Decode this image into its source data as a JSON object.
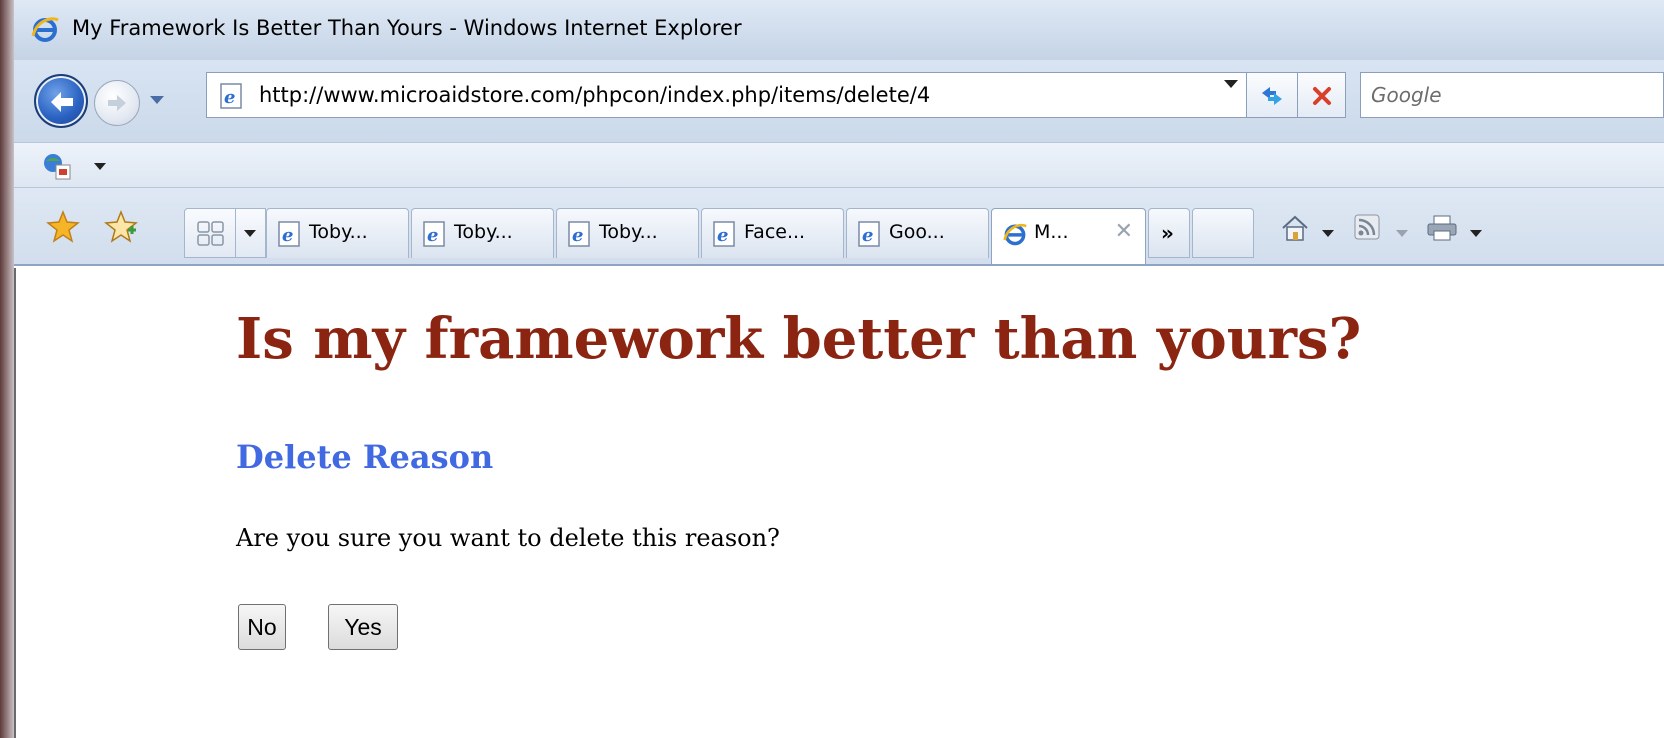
{
  "window": {
    "title": "My Framework Is Better Than Yours - Windows Internet Explorer"
  },
  "nav": {
    "address": "http://www.microaidstore.com/phpcon/index.php/items/delete/4",
    "search_placeholder": "Google"
  },
  "tabs": [
    {
      "label": "Toby...",
      "active": false
    },
    {
      "label": "Toby...",
      "active": false
    },
    {
      "label": "Toby...",
      "active": false
    },
    {
      "label": "Face...",
      "active": false
    },
    {
      "label": "Goo...",
      "active": false
    },
    {
      "label": "M...",
      "active": true
    }
  ],
  "tab_overflow_label": "»",
  "tab_close_label": "✕",
  "page": {
    "heading": "Is my framework better than yours?",
    "subheading": "Delete Reason",
    "question": "Are you sure you want to delete this reason?",
    "no_label": "No",
    "yes_label": "Yes"
  },
  "colors": {
    "heading": "#8b2410",
    "subheading": "#4169e1"
  },
  "icons": [
    "ie-logo-icon",
    "back-arrow-icon",
    "forward-arrow-icon",
    "page-icon",
    "refresh-icon",
    "stop-icon",
    "favorites-star-icon",
    "add-favorite-icon",
    "quick-tabs-icon",
    "home-icon",
    "feeds-icon",
    "print-icon"
  ]
}
